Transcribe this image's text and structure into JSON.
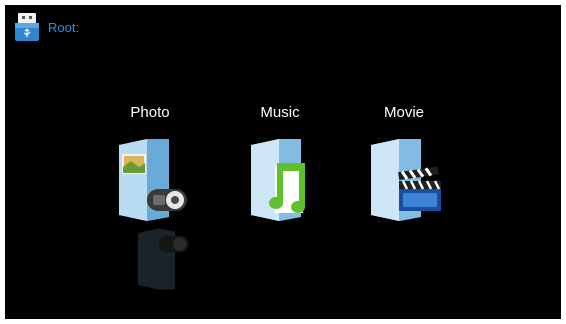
{
  "header": {
    "root_label": "Root:",
    "icon": "usb-drive-icon"
  },
  "media_items": [
    {
      "label": "Photo",
      "icon": "photo-folder-icon",
      "selected": true
    },
    {
      "label": "Music",
      "icon": "music-folder-icon",
      "selected": false
    },
    {
      "label": "Movie",
      "icon": "movie-folder-icon",
      "selected": false
    }
  ],
  "colors": {
    "background": "#000000",
    "accent": "#2f8fe0",
    "music_note": "#5ec12a"
  }
}
